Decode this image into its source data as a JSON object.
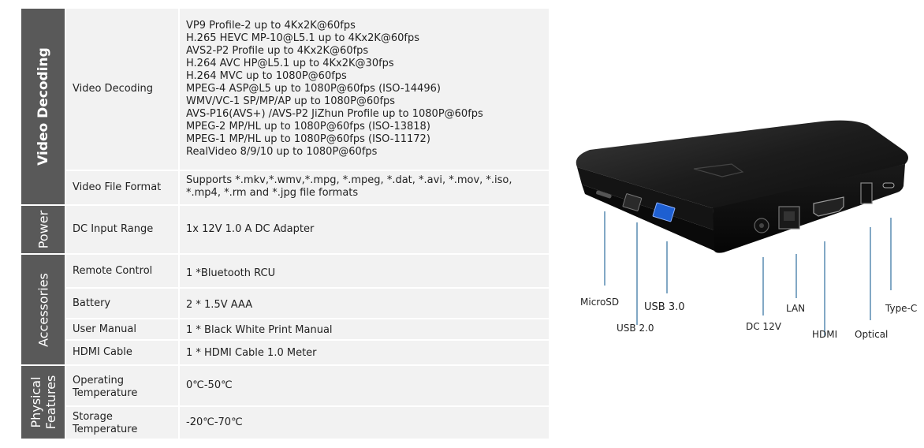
{
  "categories": {
    "video": "Video Decoding",
    "power": "Power",
    "accessories": "Accessories",
    "physical_line1": "Physical",
    "physical_line2": "Features"
  },
  "rows": {
    "video_decoding": {
      "name": "Video Decoding",
      "lines": [
        "VP9 Profile-2 up to 4Kx2K@60fps",
        "H.265 HEVC MP-10@L5.1 up to 4Kx2K@60fps",
        "AVS2-P2 Profile up to 4Kx2K@60fps",
        "H.264 AVC HP@L5.1 up to 4Kx2K@30fps",
        "H.264 MVC up to 1080P@60fps",
        "MPEG-4 ASP@L5 up to 1080P@60fps (ISO-14496)",
        "WMV/VC-1 SP/MP/AP up to 1080P@60fps",
        "AVS-P16(AVS+) /AVS-P2 JiZhun Profile up to 1080P@60fps",
        "MPEG-2 MP/HL up to 1080P@60fps (ISO-13818)",
        "MPEG-1 MP/HL up to 1080P@60fps (ISO-11172)",
        "RealVideo 8/9/10 up to 1080P@60fps"
      ]
    },
    "video_file_format": {
      "name": "Video File Format",
      "line1": "Supports *.mkv,*.wmv,*.mpg, *.mpeg, *.dat, *.avi, *.mov, *.iso,",
      "line2": "*.mp4, *.rm and *.jpg file formats"
    },
    "dc_input": {
      "name": "DC Input Range",
      "value": "1x 12V 1.0 A DC Adapter"
    },
    "remote": {
      "name": "Remote Control",
      "value": "1 *Bluetooth RCU"
    },
    "battery": {
      "name": "Battery",
      "value": "2 * 1.5V AAA"
    },
    "manual": {
      "name": "User Manual",
      "value": "1 * Black White Print Manual"
    },
    "hdmi_cable": {
      "name": "HDMI Cable",
      "value": "1 * HDMI Cable 1.0 Meter"
    },
    "op_temp": {
      "name1": "Operating",
      "name2": "Temperature",
      "value": "0℃-50℃"
    },
    "st_temp": {
      "name1": "Storage",
      "name2": "Temperature",
      "value": "-20℃-70℃"
    }
  },
  "ports": {
    "microsd": "MicroSD",
    "usb2": "USB 2.0",
    "usb3": "USB 3.0",
    "dc": "DC 12V",
    "lan": "LAN",
    "hdmi": "HDMI",
    "optical": "Optical",
    "typec": "Type-C"
  },
  "colors": {
    "category_bg": "#595959",
    "cell_bg": "#f2f2f2",
    "leader_line": "#2e6e9e"
  }
}
